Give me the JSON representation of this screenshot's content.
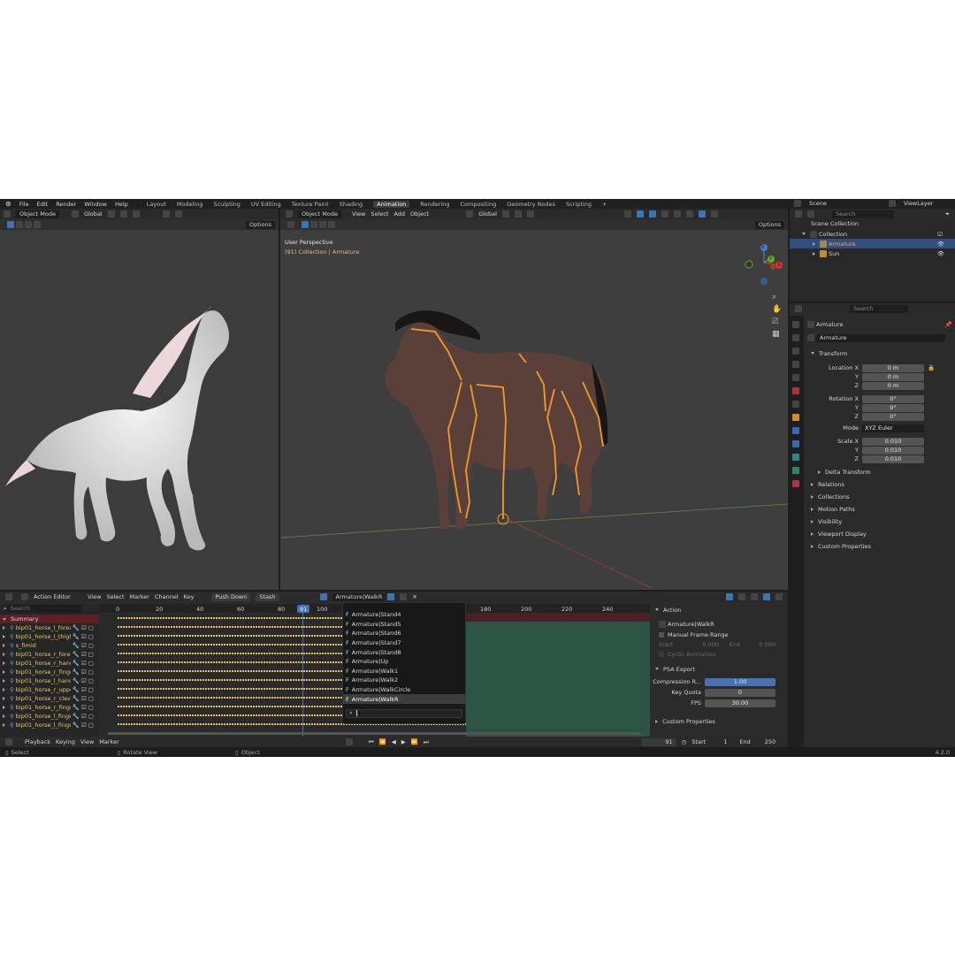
{
  "menus": [
    "File",
    "Edit",
    "Render",
    "Window",
    "Help"
  ],
  "workspaces": [
    "Layout",
    "Modeling",
    "Sculpting",
    "UV Editing",
    "Texture Paint",
    "Shading",
    "Animation",
    "Rendering",
    "Compositing",
    "Geometry Nodes",
    "Scripting",
    "+"
  ],
  "active_workspace": "Animation",
  "scene": {
    "label": "Scene",
    "viewlayer": "ViewLayer"
  },
  "left_viewport": {
    "mode": "Object Mode",
    "orientation": "Global",
    "options": "Options"
  },
  "main_viewport": {
    "mode": "Object Mode",
    "menus": [
      "View",
      "Select",
      "Add",
      "Object"
    ],
    "orientation": "Global",
    "options": "Options",
    "overlay_title": "User Perspective",
    "overlay_frame": "(91)",
    "overlay_collection": "Collection",
    "overlay_object": "Armature",
    "gizmo": {
      "x": "X",
      "y": "Y",
      "z": "Z"
    }
  },
  "outliner": {
    "search_placeholder": "Search",
    "root": "Scene Collection",
    "collection": "Collection",
    "items": [
      {
        "name": "Armature"
      },
      {
        "name": "Sun"
      }
    ]
  },
  "properties": {
    "search_placeholder": "Search",
    "context": "Armature",
    "object_name": "Armature",
    "transform_title": "Transform",
    "location_label": "Location X",
    "rotation_label": "Rotation X",
    "scale_label": "Scale X",
    "y": "Y",
    "z": "Z",
    "location": [
      "0 m",
      "0 m",
      "0 m"
    ],
    "rotation": [
      "0°",
      "0°",
      "0°"
    ],
    "mode_label": "Mode",
    "mode_value": "XYZ Euler",
    "scale": [
      "0.010",
      "0.010",
      "0.010"
    ],
    "delta": "Delta Transform",
    "panels": [
      "Relations",
      "Collections",
      "Motion Paths",
      "Visibility",
      "Viewport Display",
      "Custom Properties"
    ]
  },
  "action_editor": {
    "editor": "Action Editor",
    "menus": [
      "View",
      "Select",
      "Marker",
      "Channel",
      "Key"
    ],
    "push_down": "Push Down",
    "stash": "Stash",
    "action_name": "Armature|WalkR",
    "search_placeholder": "Search",
    "ruler": [
      "0",
      "20",
      "40",
      "60",
      "80",
      "91",
      "100",
      "180",
      "200",
      "220",
      "240"
    ],
    "current_frame": "91",
    "summary": "Summary",
    "channels": [
      "bip01_horse_l_forear",
      "bip01_horse_l_thigh",
      "s_fimid",
      "bip01_horse_r_forear",
      "bip01_horse_r_hand",
      "bip01_horse_r_finger",
      "bip01_horse_l_hand",
      "bip01_horse_r_upper",
      "bip01_horse_r_clavicl",
      "bip01_horse_r_finger",
      "bip01_horse_l_finger",
      "bip01_horse_l_finger"
    ],
    "dropdown": [
      "Armature|Stand4",
      "Armature|Stand5",
      "Armature|Stand6",
      "Armature|Stand7",
      "Armature|Stand8",
      "Armature|Up",
      "Armature|Walk1",
      "Armature|Walk2",
      "Armature|WalkCircle",
      "Armature|WalkR"
    ],
    "dropdown_prefix": "F",
    "dropdown_selected": "Armature|WalkR"
  },
  "sidebar": {
    "action_title": "Action",
    "action_name": "Armature|WalkR",
    "manual_range": "Manual Frame Range",
    "start": "Start",
    "start_val": "0.000",
    "end": "End",
    "end_val": "0.000",
    "cyclic": "Cyclic Animation",
    "psa_title": "PSA Export",
    "compression_label": "Compression R...",
    "compression": "1.00",
    "key_quota_label": "Key Quota",
    "key_quota": "0",
    "fps_label": "FPS",
    "fps": "30.00",
    "custom": "Custom Properties"
  },
  "timeline": {
    "menus": [
      "Playback",
      "Keying",
      "View",
      "Marker"
    ],
    "frame": "91",
    "start_label": "Start",
    "start": "1",
    "end_label": "End",
    "end": "250"
  },
  "statusbar": {
    "select": "Select",
    "rotate": "Rotate View",
    "object": "Object",
    "version": "4.2.0"
  },
  "colors": {
    "accent": "#4772b3",
    "bone": "#f29a2e",
    "key": "#e2c26a",
    "selected_channel": "#5b1f24"
  }
}
